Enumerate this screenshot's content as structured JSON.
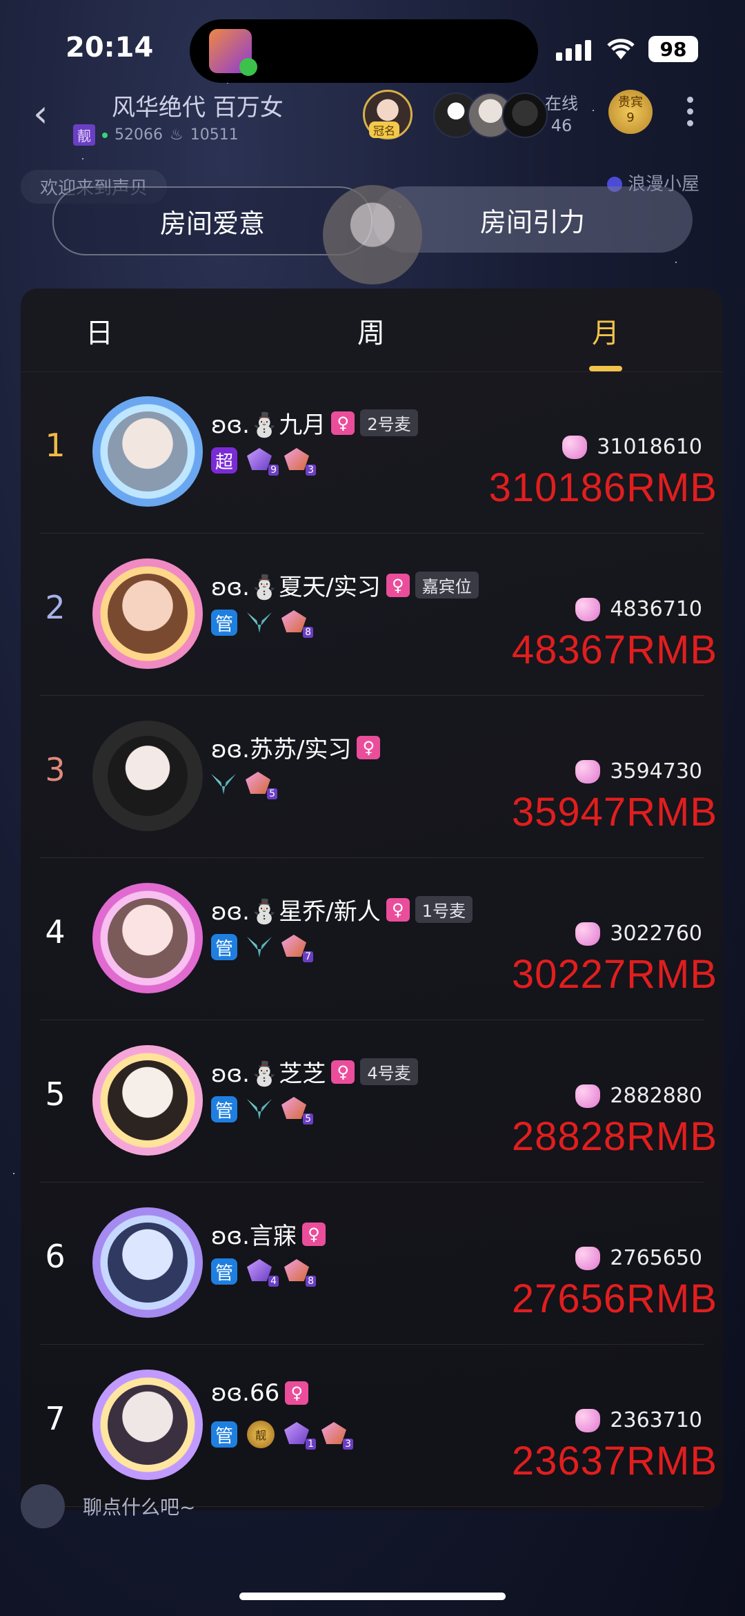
{
  "status_bar": {
    "time": "20:14",
    "battery": "98"
  },
  "room": {
    "title": "风华绝代 百万女",
    "tag": "靓",
    "id": "52066",
    "heat": "10511",
    "crown_label": "冠名",
    "online_label": "在线",
    "online_count": "46",
    "vip_label": "贵宾",
    "vip_count": "9",
    "welcome": "欢迎来到声贝",
    "right_note": "浪漫小屋"
  },
  "tabs": {
    "left": "房间爱意",
    "right": "房间引力"
  },
  "periods": {
    "day": "日",
    "week": "周",
    "month": "月",
    "active": "month"
  },
  "ranking": [
    {
      "rank": "1",
      "name": "ʚɞ.⛄九月",
      "mic": "2号麦",
      "badge": "超",
      "lv1": "9",
      "lv2": "3",
      "hearts": "31018610",
      "rmb": "310186RMB",
      "rank_color": "#f2b84a"
    },
    {
      "rank": "2",
      "name": "ʚɞ.⛄夏天/实习",
      "mic": "嘉宾位",
      "badge": "管",
      "lv2": "8",
      "hearts": "4836710",
      "rmb": "48367RMB",
      "rank_color": "#a7b2e6"
    },
    {
      "rank": "3",
      "name": "ʚɞ.苏苏/实习",
      "mic": "",
      "badge": "",
      "lv2": "5",
      "hearts": "3594730",
      "rmb": "35947RMB",
      "rank_color": "#e08a7a"
    },
    {
      "rank": "4",
      "name": "ʚɞ.⛄星乔/新人",
      "mic": "1号麦",
      "badge": "管",
      "lv2": "7",
      "hearts": "3022760",
      "rmb": "30227RMB",
      "rank_color": "#ffffff"
    },
    {
      "rank": "5",
      "name": "ʚɞ.⛄芝芝",
      "mic": "4号麦",
      "badge": "管",
      "lv2": "5",
      "hearts": "2882880",
      "rmb": "28828RMB",
      "rank_color": "#ffffff"
    },
    {
      "rank": "6",
      "name": "ʚɞ.言寐",
      "mic": "",
      "badge": "管",
      "lv1": "4",
      "lv2": "8",
      "hearts": "2765650",
      "rmb": "27656RMB",
      "rank_color": "#ffffff"
    },
    {
      "rank": "7",
      "name": "ʚɞ.66",
      "mic": "",
      "badge": "管",
      "gold": "靓",
      "lv1": "1",
      "lv2": "3",
      "hearts": "2363710",
      "rmb": "23637RMB",
      "rank_color": "#ffffff"
    }
  ],
  "bottom": {
    "hint": "聊点什么吧~"
  }
}
